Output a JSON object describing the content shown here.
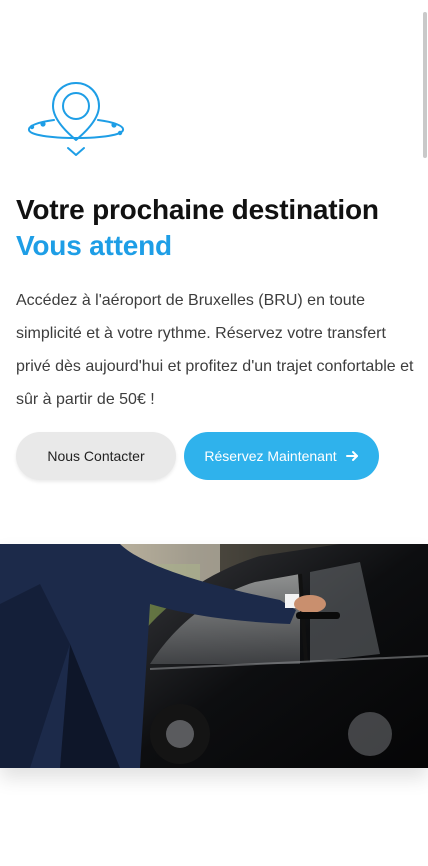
{
  "hero": {
    "icon": "location-pin-orbit-icon",
    "title_line1": "Votre prochaine destination",
    "title_line2": "Vous attend",
    "description": "Accédez à l'aéroport de Bruxelles (BRU) en toute simplicité et à votre rythme. Réservez votre transfert privé dès aujourd'hui et profitez d'un trajet confortable et sûr à partir de 50€ !"
  },
  "buttons": {
    "contact_label": "Nous Contacter",
    "book_label": "Réservez Maintenant",
    "book_icon": "arrow-right-icon"
  },
  "image": {
    "subject": "chauffeur-opening-car-door-photo"
  },
  "colors": {
    "accent": "#1e9ee6",
    "primary_button": "#2fb2ec",
    "secondary_button": "#e9e9e9",
    "title_text": "#111111",
    "body_text": "#3d3d3d"
  }
}
